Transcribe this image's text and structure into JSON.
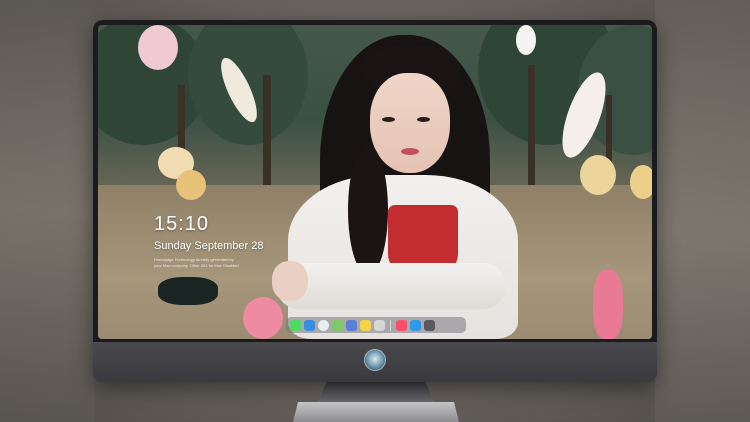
{
  "lock_screen": {
    "time": "15:10",
    "date": "Sunday September 28",
    "note_line1": "Homepage Technology Already generated by",
    "note_line2": "your Mac company. Other 201 for Mac Disabled"
  },
  "dock": {
    "icons": [
      {
        "name": "messages-icon",
        "color": "#4cd964"
      },
      {
        "name": "finder-icon",
        "color": "#3b8de0"
      },
      {
        "name": "safari-icon",
        "color": "#e9eef2"
      },
      {
        "name": "maps-icon",
        "color": "#7fc96b"
      },
      {
        "name": "photos-icon",
        "color": "#5b7fd6"
      },
      {
        "name": "notes-icon",
        "color": "#f5d34a"
      },
      {
        "name": "preview-icon",
        "color": "#d6d6d6"
      },
      {
        "name": "music-icon",
        "color": "#fa4e6a"
      },
      {
        "name": "app-store-icon",
        "color": "#2f9be8"
      },
      {
        "name": "camera-icon",
        "color": "#5a5a5e"
      }
    ]
  },
  "monitor": {
    "logo": "monitor-logo-icon"
  }
}
